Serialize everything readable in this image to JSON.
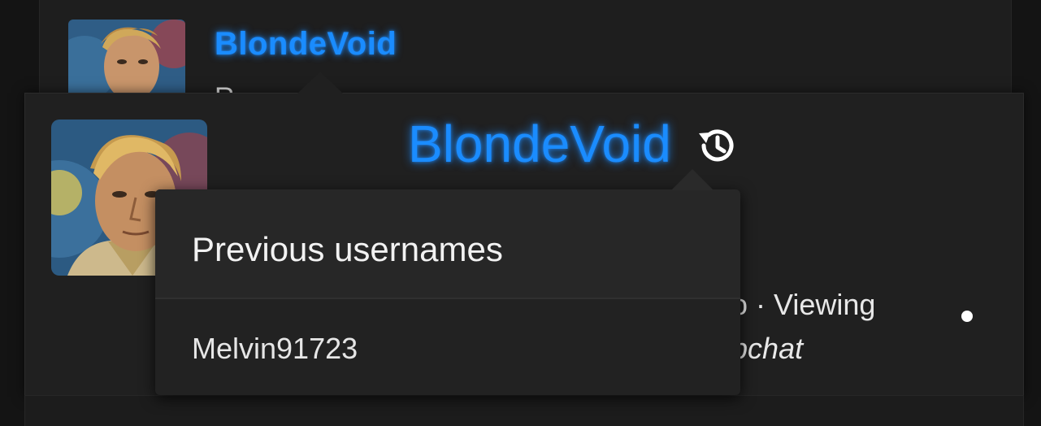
{
  "background_card": {
    "username": "BlondeVoid",
    "cut_text": "R"
  },
  "user_card": {
    "username": "BlondeVoid",
    "meta_line": "go · Viewing",
    "meta_app": "apchat",
    "icon": "history-icon"
  },
  "dropdown": {
    "title": "Previous usernames",
    "items": [
      {
        "label": "Melvin91723"
      }
    ]
  },
  "colors": {
    "username_accent": "#1a8cff",
    "card_bg": "#202020",
    "dropdown_bg": "#222222",
    "page_bg": "#141414"
  }
}
